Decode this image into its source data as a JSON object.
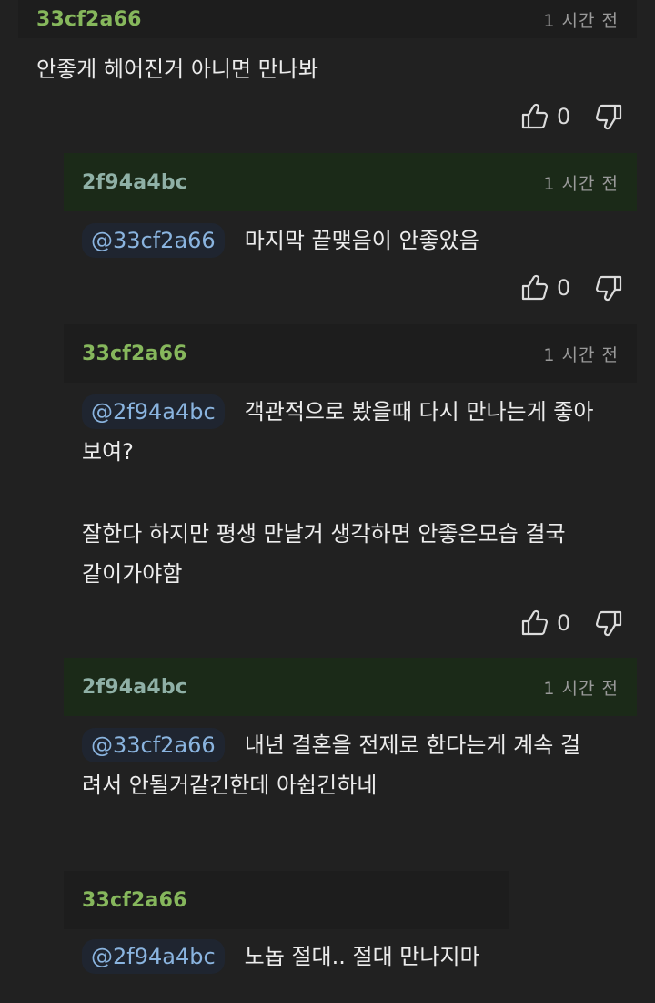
{
  "comments": [
    {
      "author": "33cf2a66",
      "time": "1 시간 전",
      "mention": "",
      "text": "안좋게 헤어진거 아니면 만나봐",
      "text2": "",
      "likes": "0"
    },
    {
      "author": "2f94a4bc",
      "time": "1 시간 전",
      "mention": "@33cf2a66",
      "text": "마지막 끝맺음이 안좋았음",
      "likes": "0"
    },
    {
      "author": "33cf2a66",
      "time": "1 시간 전",
      "mention": "@2f94a4bc",
      "text": "객관적으로 봤을때 다시 만나는게 좋아",
      "text_cont": "보여?",
      "text2_line1": "잘한다 하지만 평생 만날거 생각하면 안좋은모습 결국",
      "text2_line2": "같이가야함",
      "likes": "0"
    },
    {
      "author": "2f94a4bc",
      "time": "1 시간 전",
      "mention": "@33cf2a66",
      "text": "내년 결혼을 전제로 한다는게 계속 걸",
      "text_cont": "려서 안될거같긴한데 아쉽긴하네"
    },
    {
      "author": "33cf2a66",
      "mention": "@2f94a4bc",
      "text": "노놉 절대.. 절대 만나지마"
    }
  ]
}
